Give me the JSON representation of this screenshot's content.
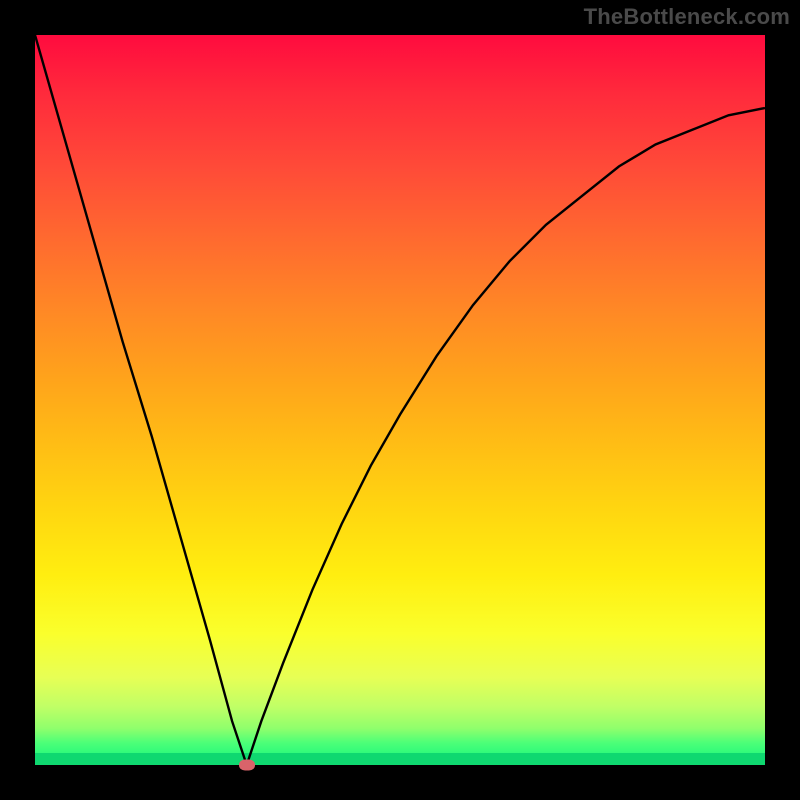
{
  "watermark": "TheBottleneck.com",
  "colors": {
    "background": "#000000",
    "gradient_top": "#ff0b3e",
    "gradient_bottom": "#11f57c",
    "curve": "#000000",
    "marker": "#d9636a"
  },
  "chart_data": {
    "type": "line",
    "title": "",
    "xlabel": "",
    "ylabel": "",
    "xlim": [
      0,
      100
    ],
    "ylim": [
      0,
      100
    ],
    "grid": false,
    "legend": false,
    "annotations": [],
    "minimum_marker": {
      "x": 29,
      "y": 0
    },
    "series": [
      {
        "name": "bottleneck-curve",
        "x": [
          0,
          4,
          8,
          12,
          16,
          20,
          24,
          27,
          29,
          31,
          34,
          38,
          42,
          46,
          50,
          55,
          60,
          65,
          70,
          75,
          80,
          85,
          90,
          95,
          100
        ],
        "values": [
          100,
          86,
          72,
          58,
          45,
          31,
          17,
          6,
          0,
          6,
          14,
          24,
          33,
          41,
          48,
          56,
          63,
          69,
          74,
          78,
          82,
          85,
          87,
          89,
          90
        ]
      }
    ]
  }
}
